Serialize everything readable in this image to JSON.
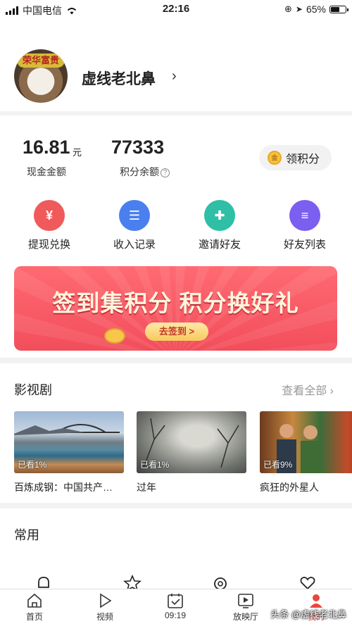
{
  "status_bar": {
    "carrier": "中国电信",
    "time": "22:16",
    "battery": "65%",
    "battery_level": 0.65
  },
  "profile": {
    "name": "虚线老北鼻",
    "avatar_banner": "荣华富贵"
  },
  "wallet": {
    "cash_value": "16.81",
    "cash_unit": "元",
    "cash_label": "现金金额",
    "points_value": "77333",
    "points_label": "积分余额",
    "claim_label": "领积分",
    "coin_text": "金"
  },
  "actions": [
    {
      "label": "提现兑换",
      "icon": "yen-icon",
      "glyph": "¥",
      "color": "#f05a5a"
    },
    {
      "label": "收入记录",
      "icon": "receipt-icon",
      "glyph": "☰",
      "color": "#4a7ff0"
    },
    {
      "label": "邀请好友",
      "icon": "add-friend-icon",
      "glyph": "✚",
      "color": "#2fbfa7"
    },
    {
      "label": "好友列表",
      "icon": "friend-list-icon",
      "glyph": "≡",
      "color": "#7a5ff0"
    }
  ],
  "banner": {
    "title": "签到集积分 积分换好礼",
    "cta": "去签到 >"
  },
  "films_section": {
    "title": "影视剧",
    "see_all": "查看全部",
    "items": [
      {
        "title": "百炼成钢：中国共产…",
        "watched": "已看1%"
      },
      {
        "title": "过年",
        "watched": "已看1%"
      },
      {
        "title": "疯狂的外星人",
        "watched": "已看9%"
      }
    ]
  },
  "common_section": {
    "title": "常用"
  },
  "tabbar": {
    "tabs": [
      {
        "label": "首页",
        "icon": "home-icon"
      },
      {
        "label": "视频",
        "icon": "play-icon"
      },
      {
        "label": "09:19",
        "icon": "calendar-check-icon"
      },
      {
        "label": "放映厅",
        "icon": "screen-icon"
      },
      {
        "label": "我的",
        "icon": "profile-icon"
      }
    ],
    "watermark": "头条 @虚线老北鼻"
  }
}
